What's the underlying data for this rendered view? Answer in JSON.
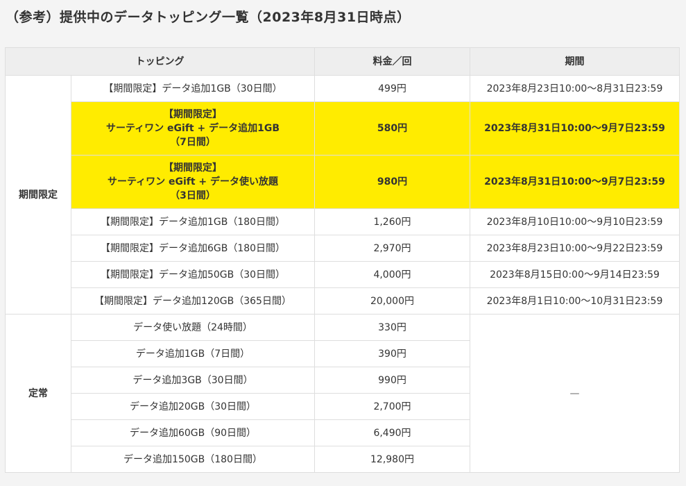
{
  "title": "（参考）提供中のデータトッピング一覧（2023年8月31日時点）",
  "table": {
    "headers": {
      "topping": "トッピング",
      "price": "料金／回",
      "period": "期間"
    },
    "groups": [
      {
        "label": "期間限定",
        "rows": [
          {
            "name_lines": [
              "【期間限定】データ追加1GB（30日間）"
            ],
            "price": "499円",
            "period": "2023年8月23日10:00～8月31日23:59",
            "highlight": false
          },
          {
            "name_lines": [
              "【期間限定】",
              "サーティワン eGift + データ追加1GB",
              "（7日間）"
            ],
            "price": "580円",
            "period": "2023年8月31日10:00～9月7日23:59",
            "highlight": true
          },
          {
            "name_lines": [
              "【期間限定】",
              "サーティワン eGift + データ使い放題",
              "（3日間）"
            ],
            "price": "980円",
            "period": "2023年8月31日10:00～9月7日23:59",
            "highlight": true
          },
          {
            "name_lines": [
              "【期間限定】データ追加1GB（180日間）"
            ],
            "price": "1,260円",
            "period": "2023年8月10日10:00～9月10日23:59",
            "highlight": false
          },
          {
            "name_lines": [
              "【期間限定】データ追加6GB（180日間）"
            ],
            "price": "2,970円",
            "period": "2023年8月23日10:00～9月22日23:59",
            "highlight": false
          },
          {
            "name_lines": [
              "【期間限定】データ追加50GB（30日間）"
            ],
            "price": "4,000円",
            "period": "2023年8月15日0:00～9月14日23:59",
            "highlight": false
          },
          {
            "name_lines": [
              "【期間限定】データ追加120GB（365日間）"
            ],
            "price": "20,000円",
            "period": "2023年8月1日10:00～10月31日23:59",
            "highlight": false
          }
        ]
      },
      {
        "label": "定常",
        "period_shared": "—",
        "rows": [
          {
            "name_lines": [
              "データ使い放題（24時間）"
            ],
            "price": "330円"
          },
          {
            "name_lines": [
              "データ追加1GB（7日間）"
            ],
            "price": "390円"
          },
          {
            "name_lines": [
              "データ追加3GB（30日間）"
            ],
            "price": "990円"
          },
          {
            "name_lines": [
              "データ追加20GB（30日間）"
            ],
            "price": "2,700円"
          },
          {
            "name_lines": [
              "データ追加60GB（90日間）"
            ],
            "price": "6,490円"
          },
          {
            "name_lines": [
              "データ追加150GB（180日間）"
            ],
            "price": "12,980円"
          }
        ]
      }
    ]
  },
  "colors": {
    "highlight": "#ffec00",
    "header_bg": "#eeeeee",
    "border": "#dedede",
    "page_bg": "#f4f4f4"
  }
}
